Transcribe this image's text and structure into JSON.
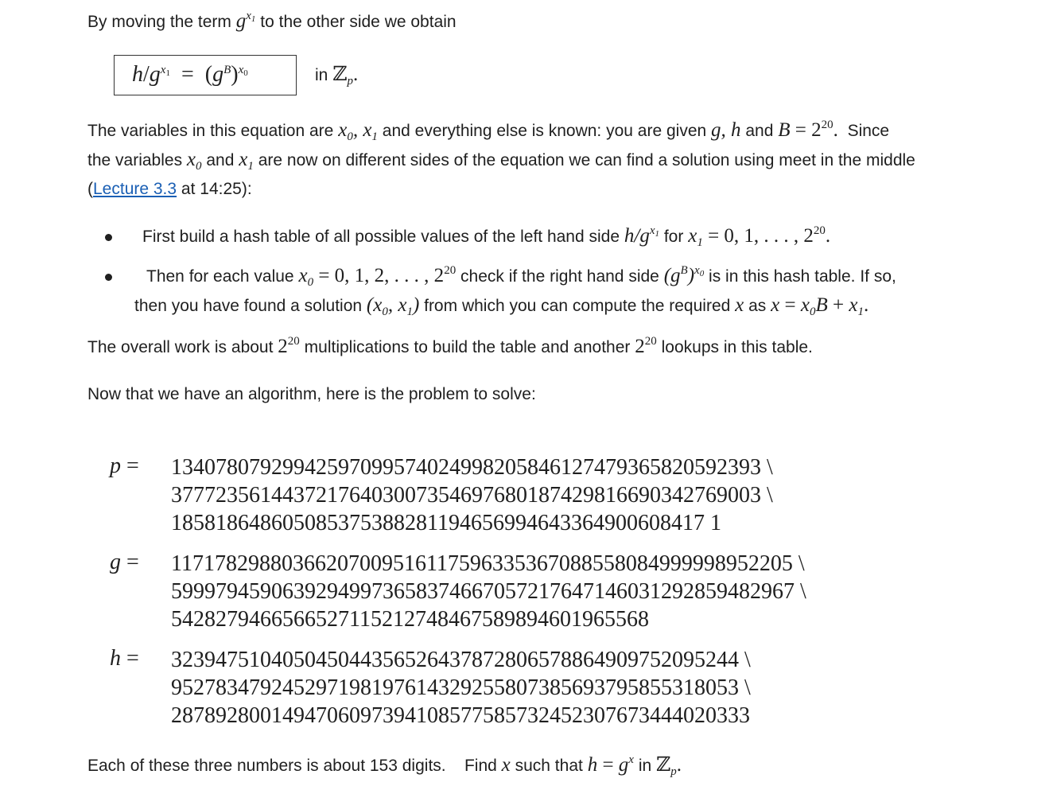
{
  "intro": {
    "before": "By moving the term",
    "after": "to the other side we obtain"
  },
  "boxed_equation": {
    "in_label": "in"
  },
  "para_variables": {
    "l1_a": "The variables in this equation are",
    "l1_b": "and everything else is known:  you are given",
    "l1_c": "and",
    "l1_d": "Since",
    "l2_a": "the variables",
    "l2_b": "and",
    "l2_c": "are now on different sides of the equation we can find a solution using meet in the middle",
    "l3_open": "(",
    "l3_link": "Lecture 3.3",
    "l3_rest": "at 14:25):"
  },
  "bullets": {
    "b1_a": "First build a hash table of all possible values of the left hand side",
    "b1_b": "for",
    "b2_a": "Then for each value",
    "b2_b": "check if the right hand side",
    "b2_c": "is in this hash table.  If so,",
    "b2_d": "then you have found a solution",
    "b2_e": "from which you can compute the required",
    "b2_f": "as"
  },
  "overall": {
    "a": "The overall work is about",
    "b": "multiplications to build the table and another",
    "c": "lookups in this table."
  },
  "problem_intro": "Now that we have an algorithm, here is the problem to solve:",
  "numbers": {
    "p": [
      "13407807929942597099574024998205846127479365820592393 \\",
      "37772356144372176403007354697680187429816690342769003 \\",
      "185818648605085375388281194656994643364900608417 1"
    ],
    "g": [
      "11717829880366207009516117596335367088558084999998952205 \\",
      "59997945906392949973658374667057217647146031292859482967 \\",
      "5428279466566527115212748467589894601965568"
    ],
    "h": [
      "323947510405045044356526437872806578864909752095244 \\",
      "952783479245297198197614329255807385693795855318053 \\",
      "2878928001494706097394108577585732452307673444020333"
    ]
  },
  "footer": {
    "a": "Each of these three numbers is about 153 digits.",
    "b": "Find",
    "c": "such that",
    "d": "in"
  }
}
